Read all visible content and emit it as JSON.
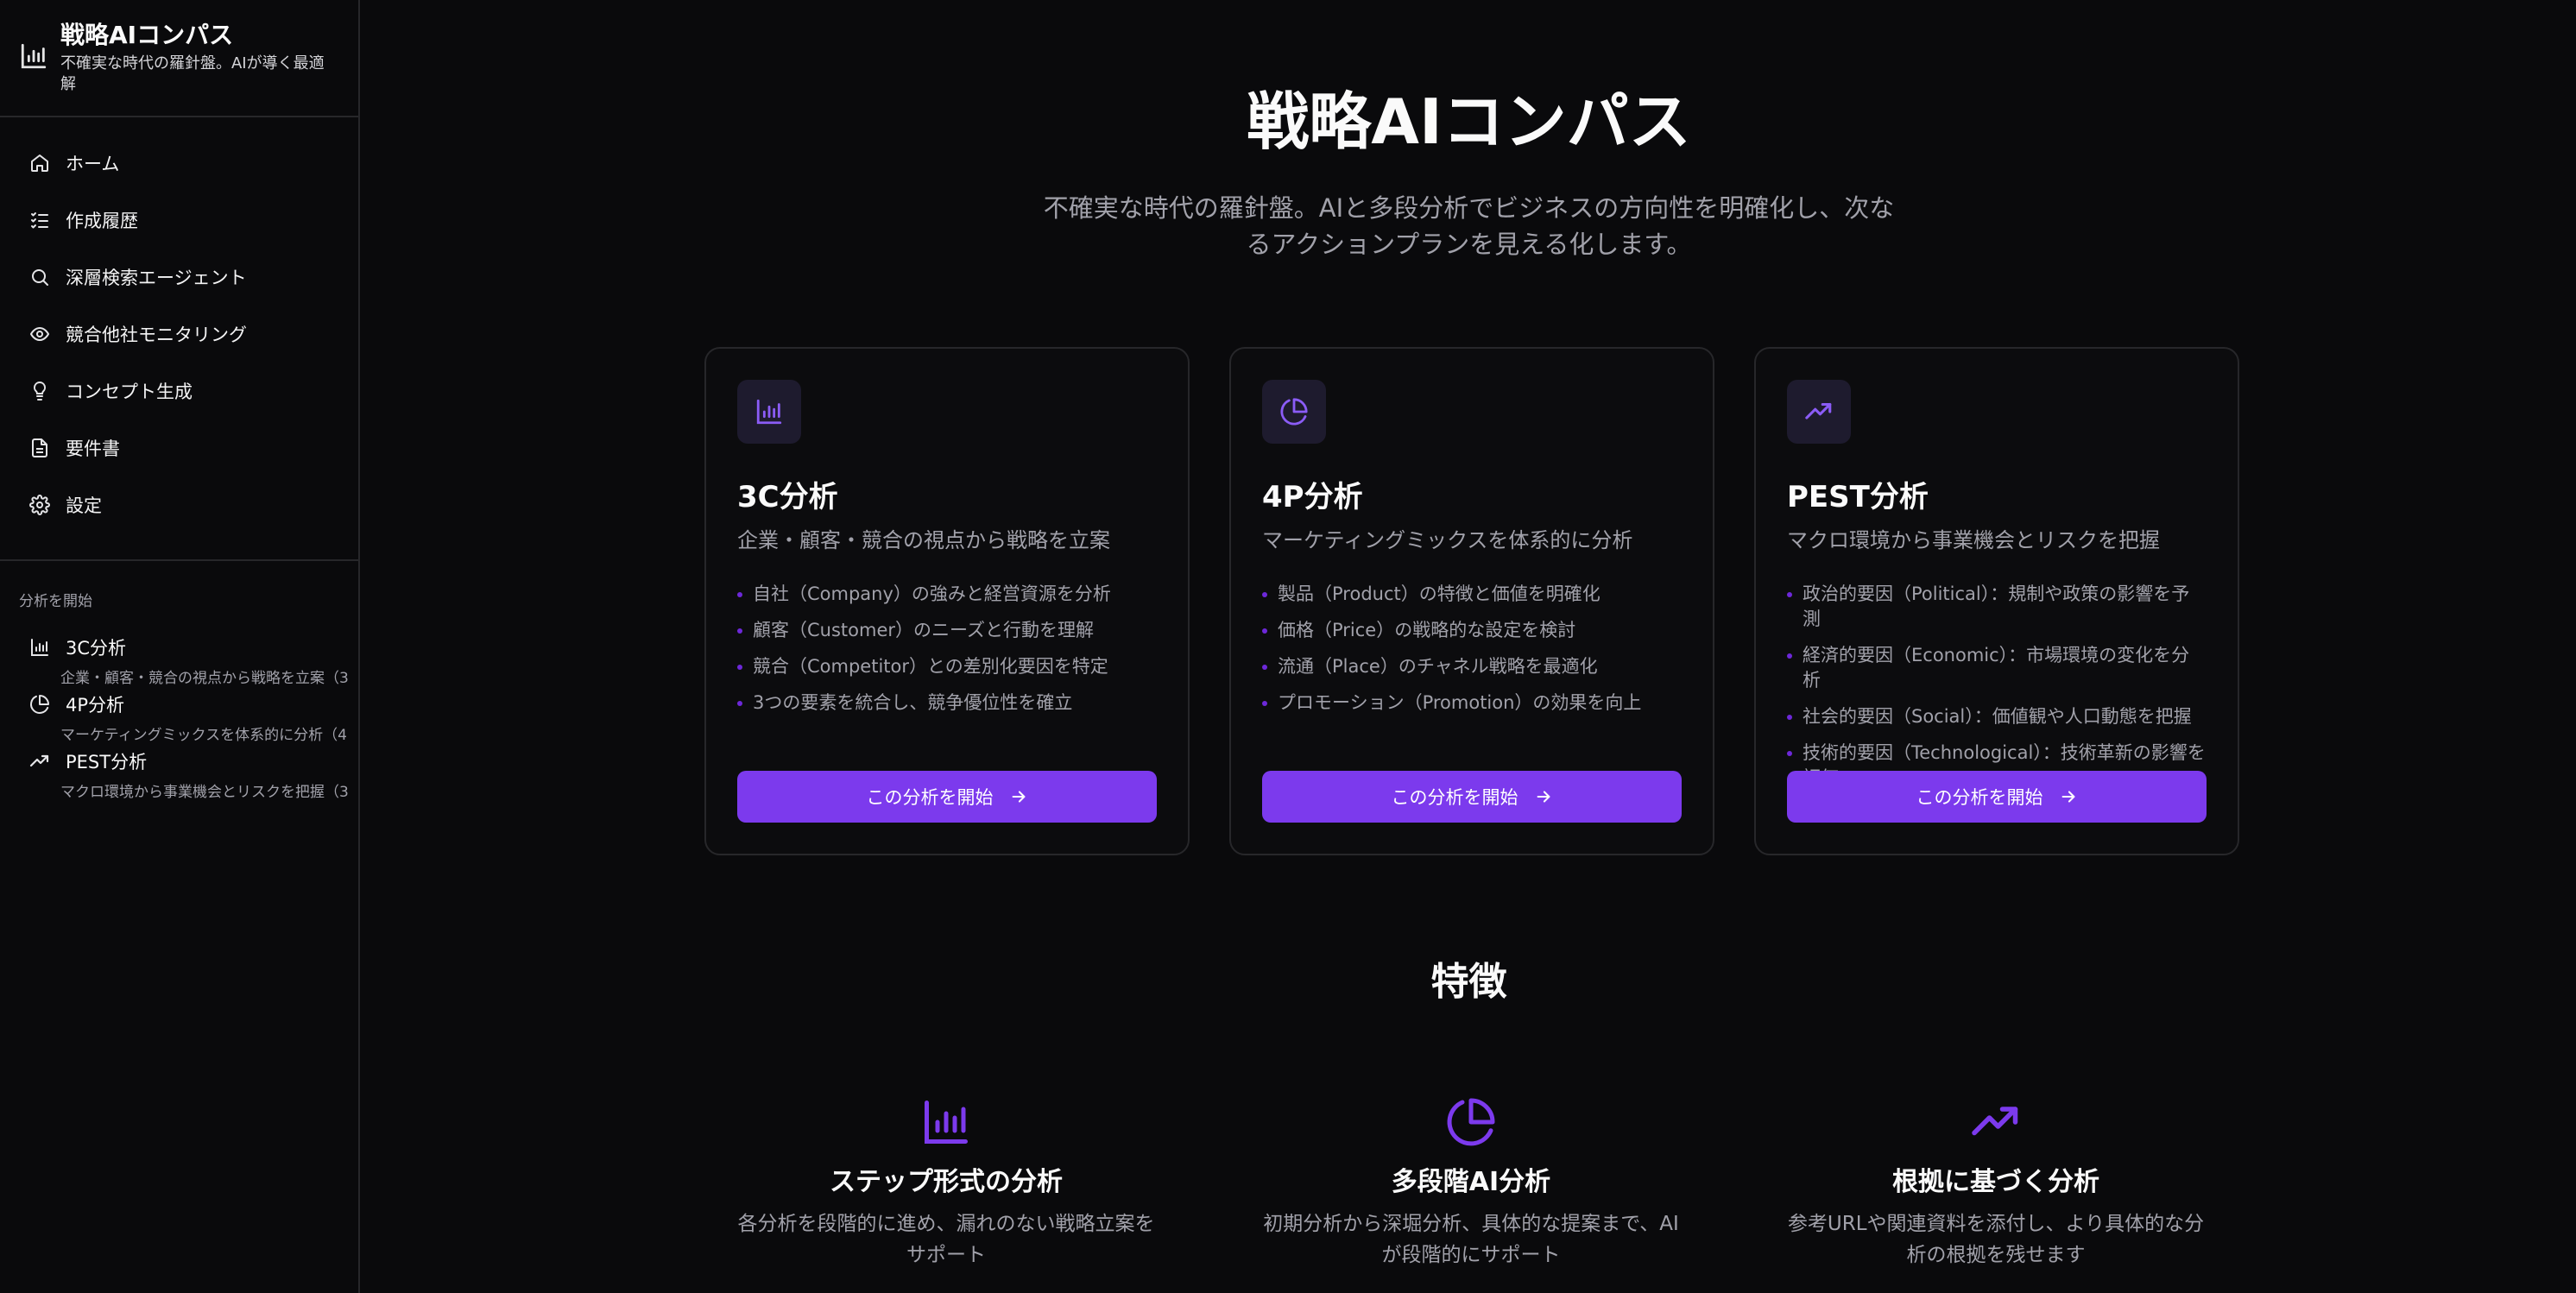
{
  "app": {
    "title": "戦略AIコンパス",
    "subtitle": "不確実な時代の羅針盤。AIが導く最適解"
  },
  "nav": [
    {
      "label": "ホーム",
      "icon": "home-icon"
    },
    {
      "label": "作成履歴",
      "icon": "list-check-icon"
    },
    {
      "label": "深層検索エージェント",
      "icon": "search-icon"
    },
    {
      "label": "競合他社モニタリング",
      "icon": "eye-icon"
    },
    {
      "label": "コンセプト生成",
      "icon": "lightbulb-icon"
    },
    {
      "label": "要件書",
      "icon": "document-icon"
    },
    {
      "label": "設定",
      "icon": "gear-icon"
    }
  ],
  "sidebar_section": {
    "label": "分析を開始",
    "items": [
      {
        "label": "3C分析",
        "desc": "企業・顧客・競合の視点から戦略を立案（3",
        "icon": "bar-chart-icon"
      },
      {
        "label": "4P分析",
        "desc": "マーケティングミックスを体系的に分析（4",
        "icon": "pie-chart-icon"
      },
      {
        "label": "PEST分析",
        "desc": "マクロ環境から事業機会とリスクを把握（3",
        "icon": "trending-up-icon"
      }
    ]
  },
  "hero": {
    "title": "戦略AIコンパス",
    "subtitle": "不確実な時代の羅針盤。AIと多段分析でビジネスの方向性を明確化し、次なるアクションプランを見える化します。"
  },
  "cards": [
    {
      "icon": "bar-chart-icon",
      "title": "3C分析",
      "subtitle": "企業・顧客・競合の視点から戦略を立案",
      "bullets": [
        "自社（Company）の強みと経営資源を分析",
        "顧客（Customer）のニーズと行動を理解",
        "競合（Competitor）との差別化要因を特定",
        "3つの要素を統合し、競争優位性を確立"
      ],
      "button": "この分析を開始"
    },
    {
      "icon": "pie-chart-icon",
      "title": "4P分析",
      "subtitle": "マーケティングミックスを体系的に分析",
      "bullets": [
        "製品（Product）の特徴と価値を明確化",
        "価格（Price）の戦略的な設定を検討",
        "流通（Place）のチャネル戦略を最適化",
        "プロモーション（Promotion）の効果を向上"
      ],
      "button": "この分析を開始"
    },
    {
      "icon": "trending-up-icon",
      "title": "PEST分析",
      "subtitle": "マクロ環境から事業機会とリスクを把握",
      "bullets": [
        "政治的要因（Political）：規制や政策の影響を予測",
        "経済的要因（Economic）：市場環境の変化を分析",
        "社会的要因（Social）：価値観や人口動態を把握",
        "技術的要因（Technological）：技術革新の影響を評価"
      ],
      "button": "この分析を開始"
    }
  ],
  "features": {
    "title": "特徴",
    "items": [
      {
        "icon": "bar-chart-icon",
        "title": "ステップ形式の分析",
        "desc": "各分析を段階的に進め、漏れのない戦略立案をサポート"
      },
      {
        "icon": "pie-chart-icon",
        "title": "多段階AI分析",
        "desc": "初期分析から深堀分析、具体的な提案まで、AIが段階的にサポート"
      },
      {
        "icon": "trending-up-icon",
        "title": "根拠に基づく分析",
        "desc": "参考URLや関連資料を添付し、より具体的な分析の根拠を残せます"
      }
    ]
  },
  "colors": {
    "background": "#0a0a0c",
    "accent": "#7c3aed",
    "border": "#27272a",
    "muted_text": "#a1a1aa"
  }
}
